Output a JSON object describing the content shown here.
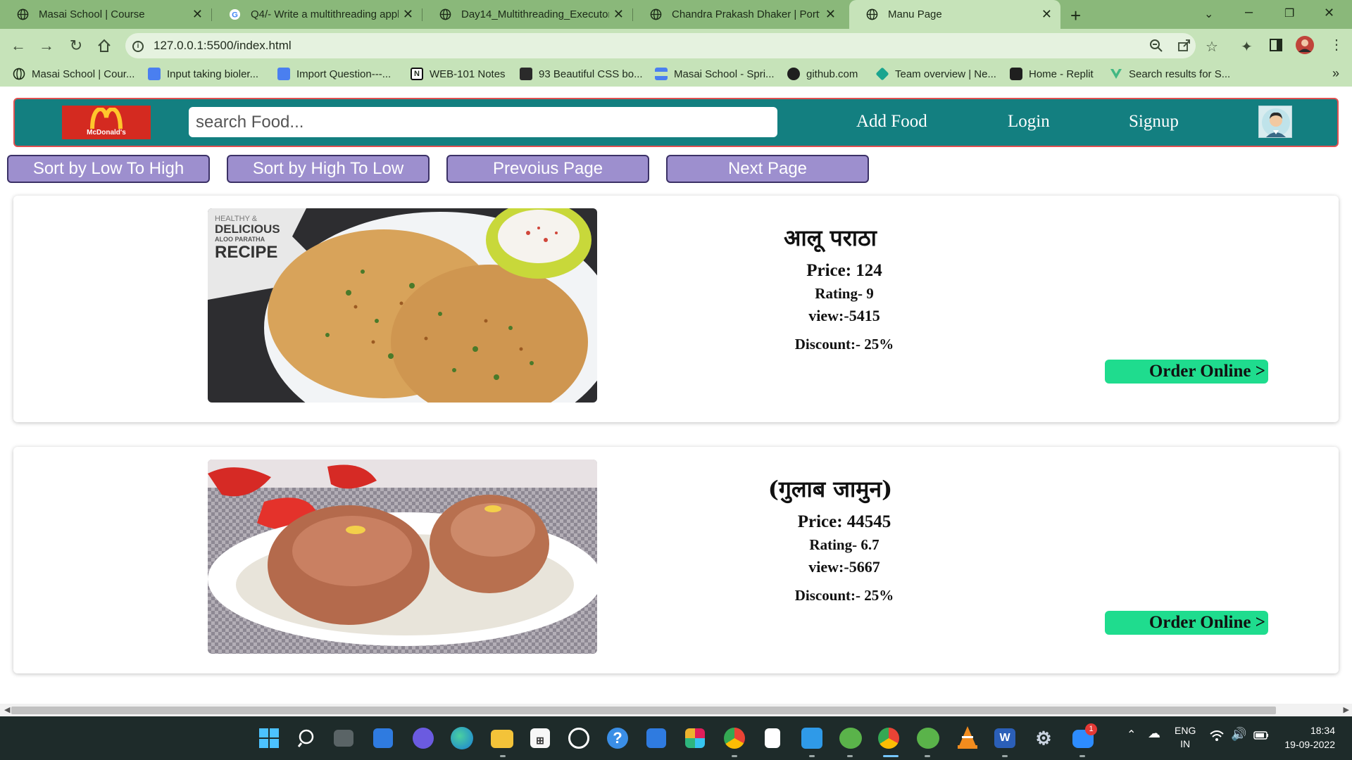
{
  "browser": {
    "tabs": [
      {
        "title": "Masai School | Course",
        "icon": "globe-icon"
      },
      {
        "title": "Q4/- Write a multithreading appl",
        "icon": "google-icon"
      },
      {
        "title": "Day14_Multithreading_Executor_",
        "icon": "globe-icon"
      },
      {
        "title": "Chandra Prakash Dhaker | Portfol",
        "icon": "globe-icon"
      },
      {
        "title": "Manu Page",
        "icon": "globe-icon",
        "active": true
      }
    ],
    "url": "127.0.0.1:5500/index.html",
    "bookmarks": [
      {
        "label": "Masai School | Cour...",
        "icon": "globe-icon"
      },
      {
        "label": "Input taking bioler...",
        "icon": "docs-icon"
      },
      {
        "label": "Import Question---...",
        "icon": "docs-icon"
      },
      {
        "label": "WEB-101 Notes",
        "icon": "notion-icon"
      },
      {
        "label": "93 Beautiful CSS bo...",
        "icon": "bookmark-icon"
      },
      {
        "label": "Masai School - Spri...",
        "icon": "sprint-icon"
      },
      {
        "label": "github.com",
        "icon": "github-icon"
      },
      {
        "label": "Team overview | Ne...",
        "icon": "diamond-icon"
      },
      {
        "label": "Home - Replit",
        "icon": "replit-icon"
      },
      {
        "label": "Search results for S...",
        "icon": "vue-icon"
      }
    ]
  },
  "page": {
    "search_placeholder": "search Food...",
    "nav": {
      "add_food": "Add Food",
      "login": "Login",
      "signup": "Signup"
    },
    "buttons": {
      "sort_low_high": "Sort by Low To High",
      "sort_high_low": "Sort by High To Low",
      "prev_page": "Prevoius Page",
      "next_page": "Next Page"
    },
    "logo_text": "McDonald's",
    "foods": [
      {
        "name": "आलू पराठा",
        "price": "Price: 124",
        "rating": "Rating- 9",
        "views": "view:-5415",
        "discount": "Discount:- 25%",
        "order": "Order Online >",
        "image_overlay": [
          "HEALTHY &",
          "DELICIOUS",
          "ALOO PARATHA",
          "RECIPE"
        ]
      },
      {
        "name": "(गुलाब जामुन)",
        "price": "Price: 44545",
        "rating": "Rating- 6.7",
        "views": "view:-5667",
        "discount": "Discount:- 25%",
        "order": "Order Online >"
      }
    ]
  },
  "taskbar": {
    "lang_top": "ENG",
    "lang_bottom": "IN",
    "time": "18:34",
    "date": "19-09-2022",
    "badge": "1"
  },
  "colors": {
    "navbar": "#137f80",
    "sort_button": "#9d8fce",
    "order_button": "#1fdc8e",
    "chrome_frame": "#8ab87a"
  }
}
